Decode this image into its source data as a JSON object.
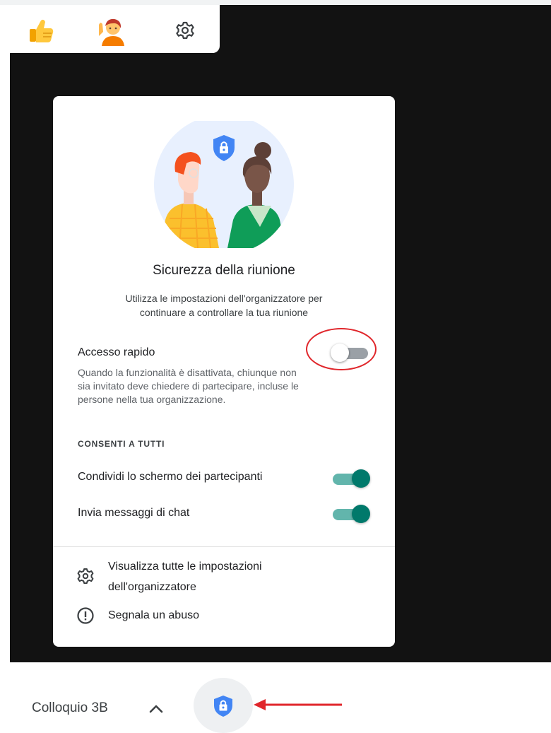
{
  "reactions": {
    "icons": [
      "thumbs-up-icon",
      "raised-hand-icon",
      "gear-icon"
    ]
  },
  "panel": {
    "title": "Sicurezza della riunione",
    "subtitle_line1": "Utilizza le impostazioni dell'organizzatore per",
    "subtitle_line2": "continuare a controllare la tua riunione",
    "quick_access": {
      "label": "Accesso rapido",
      "enabled": false,
      "desc_line1": "Quando la funzionalità è disattivata, chiunque non",
      "desc_line2": "sia invitato deve chiedere di partecipare, incluse le",
      "desc_line3": "persone nella tua organizzazione."
    },
    "allow_all_heading": "CONSENTI A TUTTI",
    "share_screen": {
      "label": "Condividi lo schermo dei partecipanti",
      "enabled": true
    },
    "chat": {
      "label": "Invia messaggi di chat",
      "enabled": true
    },
    "host_settings_line1": "Visualizza tutte le impostazioni",
    "host_settings_line2": "dell'organizzatore",
    "report_abuse": "Segnala un abuso"
  },
  "bottom_bar": {
    "meeting_name": "Colloquio 3B",
    "icons": [
      "chevron-up-icon",
      "shield-lock-icon"
    ]
  },
  "colors": {
    "accent_teal": "#00796b",
    "shield_blue": "#4285f4",
    "annotation_red": "#e0262b"
  }
}
